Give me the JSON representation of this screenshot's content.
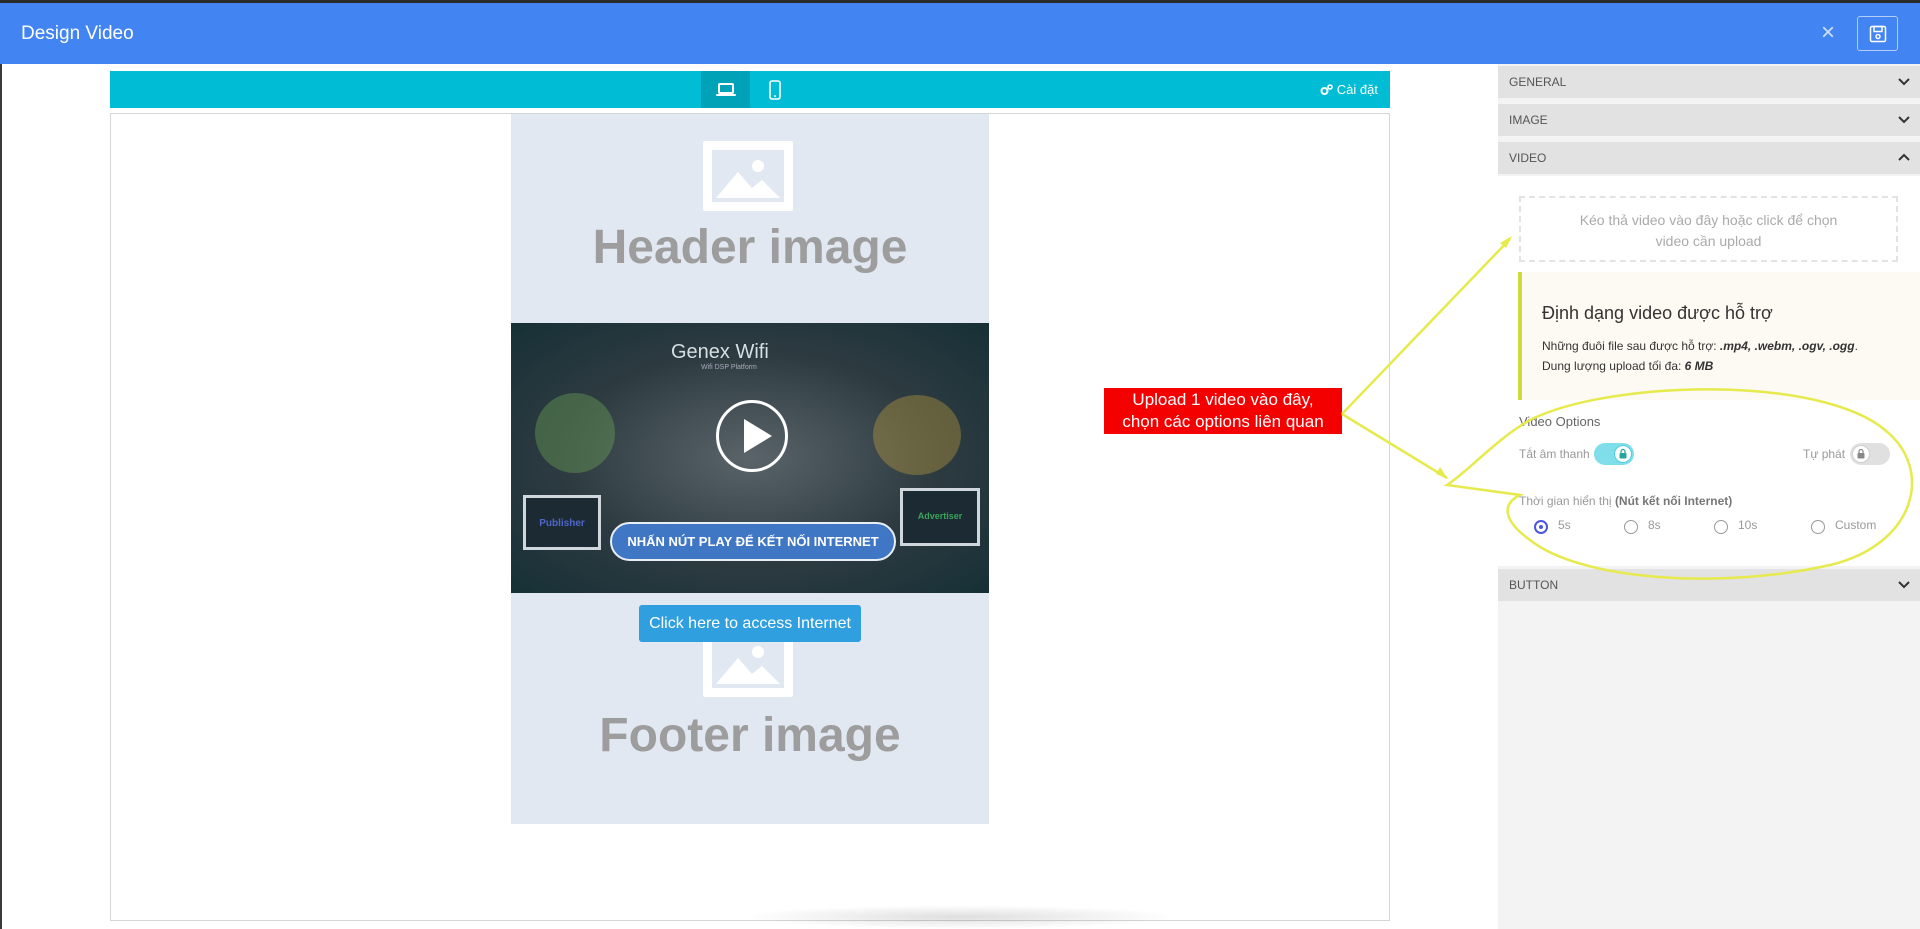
{
  "header": {
    "title": "Design Video",
    "close_icon": "×"
  },
  "toolbar": {
    "settings_label": "Cài đặt"
  },
  "preview": {
    "header_placeholder": "Header image",
    "footer_placeholder": "Footer image",
    "video_logo": "Genex Wifi",
    "video_logo_sub": "Wifi DSP Platform",
    "video_cta": "NHẤN NÚT PLAY ĐỂ KẾT NỐI INTERNET",
    "video_label_left": "Publisher",
    "video_label_right": "Advertiser",
    "access_button": "Click here to access Internet"
  },
  "annotation": {
    "line1": "Upload 1 video vào đây,",
    "line2": "chọn các options liên quan",
    "color": "#f40000",
    "highlight_color": "#e6ea4c"
  },
  "panel": {
    "sections": {
      "general": "GENERAL",
      "image": "IMAGE",
      "video": "VIDEO",
      "button": "BUTTON"
    },
    "upload_hint_line1": "Kéo thả video vào đây hoặc click để chọn",
    "upload_hint_line2": "video cần upload",
    "info_title": "Định dạng video được hỗ trợ",
    "info_formats_prefix": "Những đuôi file sau được hỗ trợ: ",
    "info_formats": ".mp4, .webm, .ogv, .ogg",
    "info_formats_suffix": ".",
    "info_size_prefix": "Dung lượng upload tối đa: ",
    "info_size": "6 MB",
    "video_options_label": "Video Options",
    "mute_label": "Tắt âm thanh",
    "mute_on": true,
    "autoplay_label": "Tự phát",
    "autoplay_on": false,
    "display_time_label": "Thời gian hiển thị ",
    "display_time_note": "(Nút kết nối Internet)",
    "display_time_options": [
      "5s",
      "8s",
      "10s",
      "Custom"
    ],
    "display_time_selected": "5s"
  },
  "colors": {
    "topbar": "#4284f1",
    "toolbar": "#00bcd4",
    "accent": "#cddc39"
  }
}
